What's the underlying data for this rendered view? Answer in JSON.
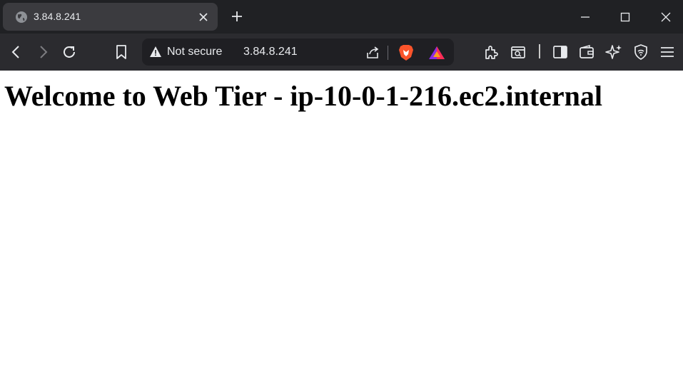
{
  "tab": {
    "title": "3.84.8.241"
  },
  "omnibox": {
    "security_label": "Not secure",
    "url": "3.84.8.241"
  },
  "page": {
    "heading": "Welcome to Web Tier - ip-10-0-1-216.ec2.internal"
  },
  "icons": {
    "tab": [
      "globe-icon",
      "close-icon"
    ],
    "window": [
      "new-tab-icon",
      "minimize-icon",
      "maximize-icon",
      "close-window-icon"
    ],
    "toolbar": [
      "back-icon",
      "forward-icon",
      "reload-icon",
      "bookmark-icon",
      "warning-icon",
      "share-icon",
      "brave-shields-icon",
      "brave-rewards-icon",
      "extensions-icon",
      "tab-search-icon",
      "sidebar-icon",
      "wallet-icon",
      "leo-ai-icon",
      "vpn-icon",
      "menu-icon"
    ]
  },
  "colors": {
    "tabstrip": "#202124",
    "active_tab": "#3b3b3f",
    "toolbar": "#2b2b2f",
    "omnibox": "#1f1f23",
    "brave_orange": "#fb542b",
    "page_bg": "#ffffff"
  }
}
